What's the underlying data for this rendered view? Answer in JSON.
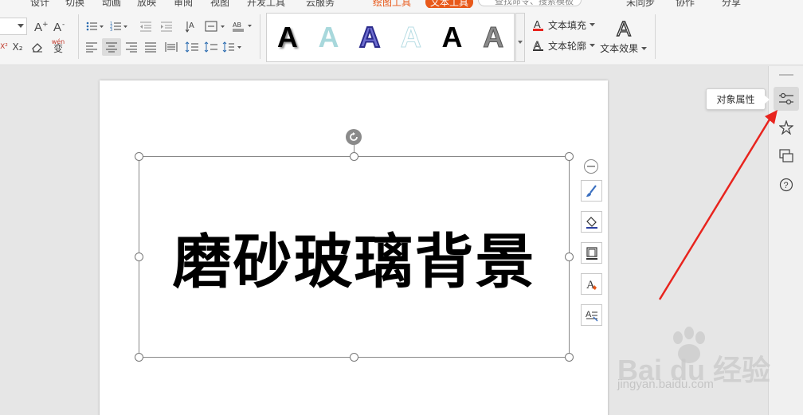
{
  "menubar": {
    "items": [
      "设计",
      "切换",
      "动画",
      "放映",
      "审阅",
      "视图",
      "开发工具",
      "云服务"
    ],
    "tab_draw": "绘图工具",
    "tab_text": "文本工具",
    "search_placeholder": "查找命令、搜索模板",
    "sync": "未同步",
    "collab": "协作",
    "share": "分享"
  },
  "ribbon": {
    "superscript": "X²",
    "subscript": "X₂",
    "phonetic": "wén",
    "gallery_letter": "A",
    "text_fill": "文本填充",
    "text_outline": "文本轮廓",
    "text_effect": "文本效果",
    "effect_letter": "A"
  },
  "canvas": {
    "text": "磨砂玻璃背景"
  },
  "side_panel": {
    "tooltip": "对象属性"
  },
  "watermark": {
    "logo": "Bai du 经验",
    "url": "jingyan.baidu.com"
  },
  "colors": {
    "accent": "#e8591a",
    "arrow": "#e8241e"
  }
}
